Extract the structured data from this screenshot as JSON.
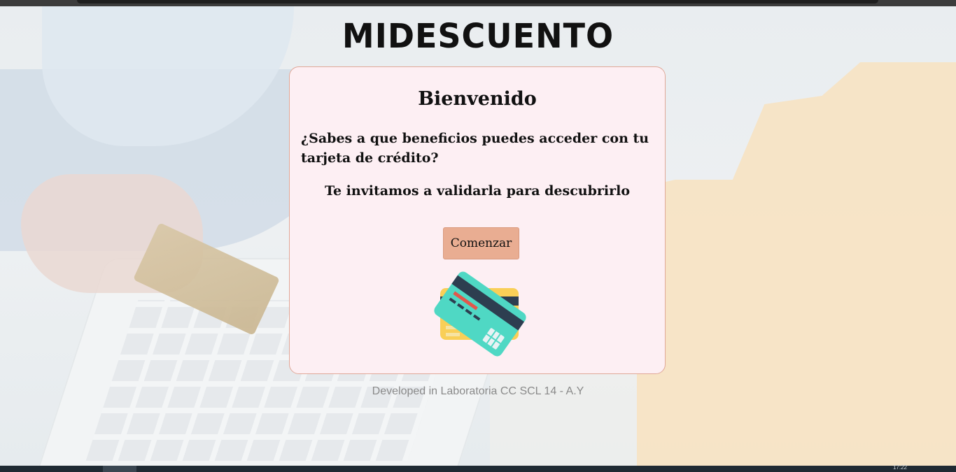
{
  "brand": {
    "logo": "MIDESCUENTO"
  },
  "welcome": {
    "title": "Bienvenido",
    "question": "¿Sabes a que beneficios puedes acceder con tu tarjeta de crédito?",
    "invite": "Te invitamos a validarla para descubrirlo",
    "start_label": "Comenzar",
    "icon": "credit-card-icon"
  },
  "footer": {
    "text": "Developed in Laboratoria CC SCL 14 - A.Y"
  },
  "taskbar": {
    "clock": "17:22"
  },
  "colors": {
    "card_background": "#fdeff3",
    "card_border": "#e0a898",
    "button": "#e9ad92",
    "icon_teal": "#4fd8c4",
    "icon_yellow": "#f9cf57",
    "icon_stripe": "#2d3e50",
    "icon_red": "#e2574c"
  }
}
